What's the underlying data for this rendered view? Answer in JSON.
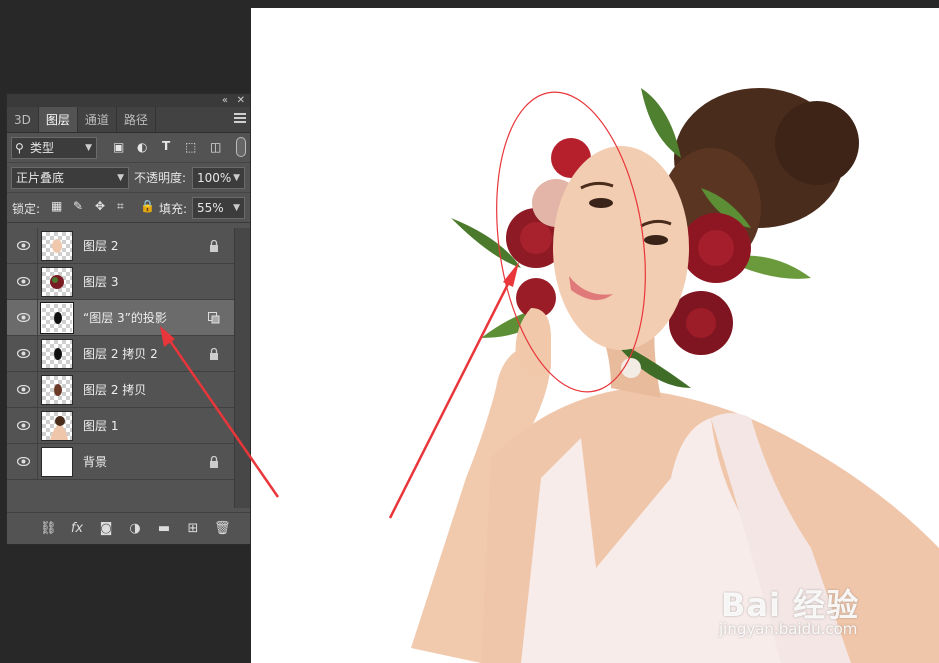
{
  "panel": {
    "tabs": [
      {
        "label": "3D"
      },
      {
        "label": "图层"
      },
      {
        "label": "通道"
      },
      {
        "label": "路径"
      }
    ],
    "filter": {
      "kind_label": "类型"
    },
    "blend": {
      "mode": "正片叠底",
      "opacity_label": "不透明度:",
      "opacity_value": "100%"
    },
    "lock": {
      "label": "锁定:",
      "fill_label": "填充:",
      "fill_value": "55%"
    },
    "layers": [
      {
        "name": "图层 2",
        "locked": true
      },
      {
        "name": "图层 3",
        "locked": false
      },
      {
        "name": "“图层 3”的投影",
        "locked": false,
        "selected": true
      },
      {
        "name": "图层 2 拷贝 2",
        "locked": true
      },
      {
        "name": "图层 2 拷贝",
        "locked": false
      },
      {
        "name": "图层 1",
        "locked": false
      },
      {
        "name": "背景",
        "locked": true
      }
    ],
    "footer_icons": [
      "link-icon",
      "fx-icon",
      "mask-icon",
      "adjustment-icon",
      "folder-icon",
      "new-layer-icon",
      "trash-icon"
    ]
  },
  "canvas": {
    "watermark_logo": "Bai 经验",
    "watermark_url": "jingyan.baidu.com"
  },
  "colors": {
    "panel_bg": "#535353",
    "selected_row": "#6b6b6b",
    "app_bg": "#282828",
    "annotation": "#e8363a"
  }
}
